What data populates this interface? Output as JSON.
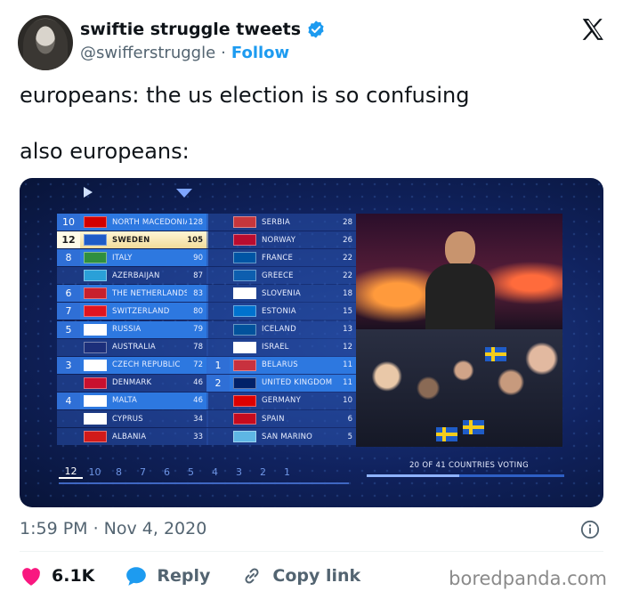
{
  "header": {
    "display_name": "swiftie struggle tweets",
    "handle": "@swifferstruggle",
    "separator": "·",
    "follow_label": "Follow"
  },
  "tweet": {
    "line1": "europeans: the us election is so confusing",
    "line2": "also europeans:"
  },
  "media": {
    "left_column": [
      {
        "pts": "10",
        "country": "NORTH MACEDONIA",
        "score": "128",
        "flag": "#d20000"
      },
      {
        "pts": "12",
        "country": "SWEDEN",
        "score": "105",
        "flag": "#1f5cc7"
      },
      {
        "pts": "8",
        "country": "ITALY",
        "score": "90",
        "flag": "#2f8f3f"
      },
      {
        "pts": "",
        "country": "AZERBAIJAN",
        "score": "87",
        "flag": "#2aa0d8"
      },
      {
        "pts": "6",
        "country": "THE NETHERLANDS",
        "score": "83",
        "flag": "#c8202d"
      },
      {
        "pts": "7",
        "country": "SWITZERLAND",
        "score": "80",
        "flag": "#e0141e"
      },
      {
        "pts": "5",
        "country": "RUSSIA",
        "score": "79",
        "flag": "#ffffff"
      },
      {
        "pts": "",
        "country": "AUSTRALIA",
        "score": "78",
        "flag": "#1c2f7a"
      },
      {
        "pts": "3",
        "country": "CZECH REPUBLIC",
        "score": "72",
        "flag": "#ffffff"
      },
      {
        "pts": "",
        "country": "DENMARK",
        "score": "46",
        "flag": "#c8102e"
      },
      {
        "pts": "4",
        "country": "MALTA",
        "score": "46",
        "flag": "#ffffff"
      },
      {
        "pts": "",
        "country": "CYPRUS",
        "score": "34",
        "flag": "#ffffff"
      },
      {
        "pts": "",
        "country": "ALBANIA",
        "score": "33",
        "flag": "#d11a1a"
      }
    ],
    "right_column": [
      {
        "pts": "",
        "country": "SERBIA",
        "score": "28",
        "flag": "#c6363c"
      },
      {
        "pts": "",
        "country": "NORWAY",
        "score": "26",
        "flag": "#ba0c2f"
      },
      {
        "pts": "",
        "country": "FRANCE",
        "score": "22",
        "flag": "#0055a4"
      },
      {
        "pts": "",
        "country": "GREECE",
        "score": "22",
        "flag": "#0d5eaf"
      },
      {
        "pts": "",
        "country": "SLOVENIA",
        "score": "18",
        "flag": "#ffffff"
      },
      {
        "pts": "",
        "country": "ESTONIA",
        "score": "15",
        "flag": "#0072ce"
      },
      {
        "pts": "",
        "country": "ICELAND",
        "score": "13",
        "flag": "#02529c"
      },
      {
        "pts": "",
        "country": "ISRAEL",
        "score": "12",
        "flag": "#ffffff"
      },
      {
        "pts": "1",
        "country": "BELARUS",
        "score": "11",
        "flag": "#c8313e"
      },
      {
        "pts": "2",
        "country": "UNITED KINGDOM",
        "score": "11",
        "flag": "#012169"
      },
      {
        "pts": "",
        "country": "GERMANY",
        "score": "10",
        "flag": "#dd0000"
      },
      {
        "pts": "",
        "country": "SPAIN",
        "score": "6",
        "flag": "#c60b1e"
      },
      {
        "pts": "",
        "country": "SAN MARINO",
        "score": "5",
        "flag": "#5eb6e4"
      }
    ],
    "scale": [
      "12",
      "10",
      "8",
      "7",
      "6",
      "5",
      "4",
      "3",
      "2",
      "1"
    ],
    "voting_status": "20 OF 41 COUNTRIES VOTING"
  },
  "footer": {
    "timestamp": "1:59 PM · Nov 4, 2020",
    "likes": "6.1K",
    "reply_label": "Reply",
    "copy_label": "Copy link",
    "watermark": "boredpanda.com"
  },
  "colors": {
    "like": "#f91880",
    "reply": "#1d9bf0",
    "follow": "#1d9bf0",
    "verified": "#1d9bf0"
  }
}
